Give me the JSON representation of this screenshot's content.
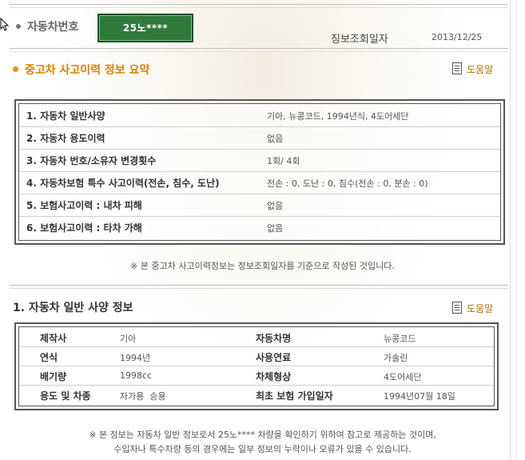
{
  "header": {
    "plate_label": "자동차번호",
    "plate_number": "25노****",
    "date_label": "징보조회일자",
    "date_value": "2013/12/25"
  },
  "summary": {
    "title": "중고차 사고이력 정보 요약",
    "help_label": "도움말",
    "rows": [
      {
        "label": "1. 자동차 일반사양",
        "value": "기아, 뉴콩코드, 1994년식, 4도어세단"
      },
      {
        "label": "2. 자동차 용도이력",
        "value": "없음"
      },
      {
        "label": "3. 자동차 번호/소유자 변경횟수",
        "value": "1회/ 4회"
      },
      {
        "label": "4. 자동차보험 특수 사고이력(전손, 침수, 도난)",
        "value": "전손 : 0, 도난 : 0, 침수(전손 : 0, 분손 : 0)"
      },
      {
        "label": "5. 보험사고이력 : 내차 피해",
        "value": "없음"
      },
      {
        "label": "6. 보험사고이력 : 타차 가해",
        "value": "없음"
      }
    ],
    "note": "※ 본 중고차 사고이력정보는 정보조회일자를 기준으로 작성된 것입니다."
  },
  "spec": {
    "title": "1. 자동차 일반 사양 정보",
    "help_label": "도움말",
    "rows": [
      {
        "label1": "제작사",
        "value1": "기아",
        "label2": "자동차명",
        "value2": "뉴콩코드"
      },
      {
        "label1": "연식",
        "value1": "1994년",
        "label2": "사용연료",
        "value2": "가솔린"
      },
      {
        "label1": "배기량",
        "value1": "1998cc",
        "label2": "차체형상",
        "value2": "4도어세단"
      },
      {
        "label1": "용도 및 차종",
        "value1": "자가용  승용",
        "label2": "최초 보험 가입일자",
        "value2": "1994년07월 18일"
      }
    ],
    "note_line1": "※ 본 정보는 자동차 일반 정보로서 25노**** 차량을 확인하기 위하여 참고로 제공하는 것이며,",
    "note_line2": "수입차나 특수차량 등의 경우에는 일부 정보의 누락이나 오류가 있을 수 있습니다."
  },
  "colors": {
    "accent_orange": "#e07f00",
    "plate_green": "#2f7a3b",
    "help_text": "#b07000"
  },
  "icons": [
    "cursor-arrow-icon",
    "bullet-icon",
    "document-icon"
  ]
}
